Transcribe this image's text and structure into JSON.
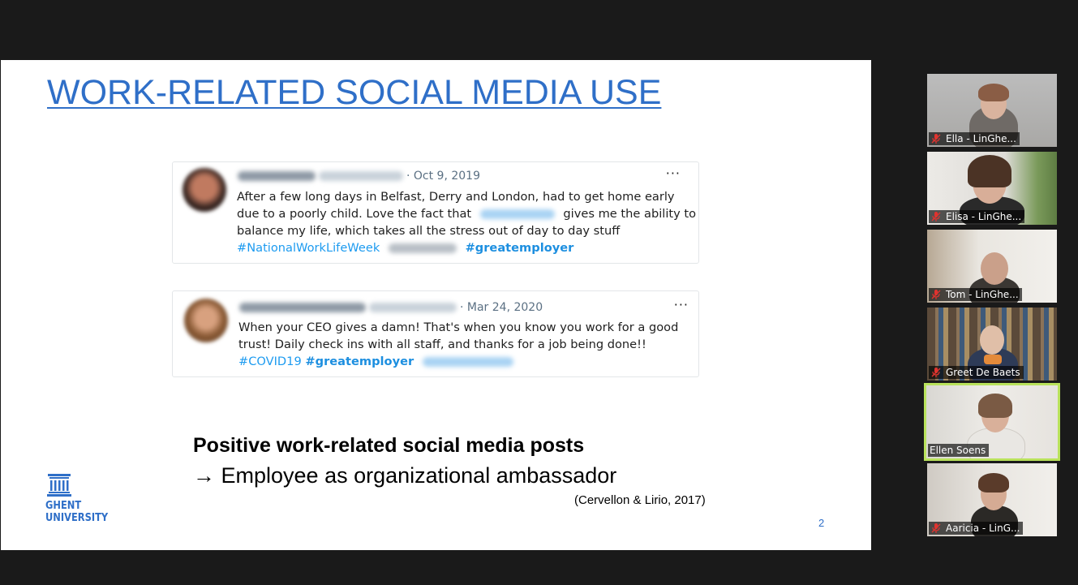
{
  "slide": {
    "title": "WORK-RELATED SOCIAL MEDIA USE",
    "tweets": [
      {
        "date": "· Oct 9, 2019",
        "more": "···",
        "lines": [
          "After a few long days in Belfast, Derry and London, had to get home early",
          "due to a poorly child. Love the fact that",
          "gives me the ability to",
          "balance my life, which takes all the stress out of day to day stuff"
        ],
        "hashtag": "#NationalWorkLifeWeek",
        "bold_hashtag": "#greatemployer"
      },
      {
        "date": "· Mar 24, 2020",
        "more": "···",
        "lines": [
          "When your CEO gives a damn! That's when you know you work for a good",
          "trust! Daily check ins with all staff, and thanks for a job being done!!"
        ],
        "hashtag": "#COVID19",
        "bold_hashtag": "#greatemployer"
      }
    ],
    "headline": "Positive work-related social media posts",
    "subline": "→ Employee as organizational ambassador",
    "citation": "(Cervellon & Lirio, 2017)",
    "page_number": "2",
    "logo": {
      "line1": "GHENT",
      "line2": "UNIVERSITY"
    }
  },
  "participants": [
    {
      "name": "Ella - LinGhe...",
      "muted": true,
      "active": false
    },
    {
      "name": "Elisa - LinGhe...",
      "muted": true,
      "active": false
    },
    {
      "name": "Tom - LinGhe...",
      "muted": true,
      "active": false
    },
    {
      "name": "Greet De Baets",
      "muted": true,
      "active": false
    },
    {
      "name": "Ellen Soens",
      "muted": false,
      "active": true
    },
    {
      "name": "Aaricia - LinG...",
      "muted": true,
      "active": false
    }
  ],
  "colors": {
    "accent": "#2f6fc8",
    "hashtag": "#1d9bf0",
    "active_speaker": "#b9e25b",
    "muted_icon": "#e0332f"
  }
}
